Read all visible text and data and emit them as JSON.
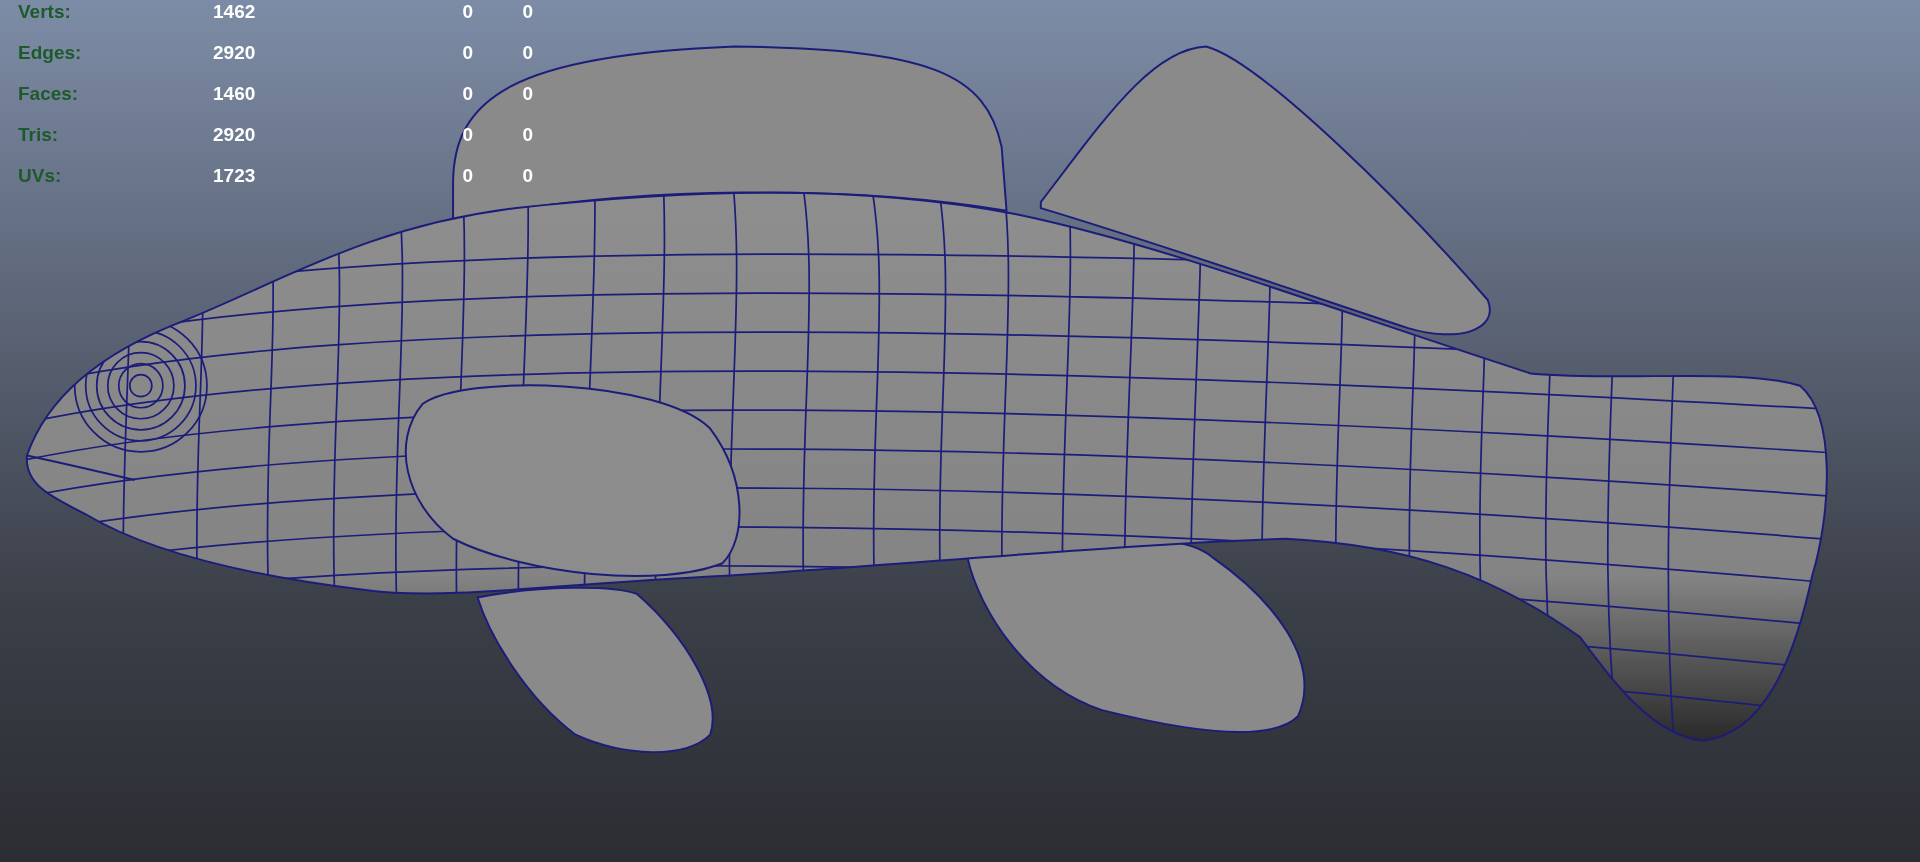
{
  "hud": {
    "rows": [
      {
        "label": "Verts:",
        "values": [
          "1462",
          "0",
          "0"
        ]
      },
      {
        "label": "Edges:",
        "values": [
          "2920",
          "0",
          "0"
        ]
      },
      {
        "label": "Faces:",
        "values": [
          "1460",
          "0",
          "0"
        ]
      },
      {
        "label": "Tris:",
        "values": [
          "2920",
          "0",
          "0"
        ]
      },
      {
        "label": "UVs:",
        "values": [
          "1723",
          "0",
          "0"
        ]
      }
    ]
  }
}
